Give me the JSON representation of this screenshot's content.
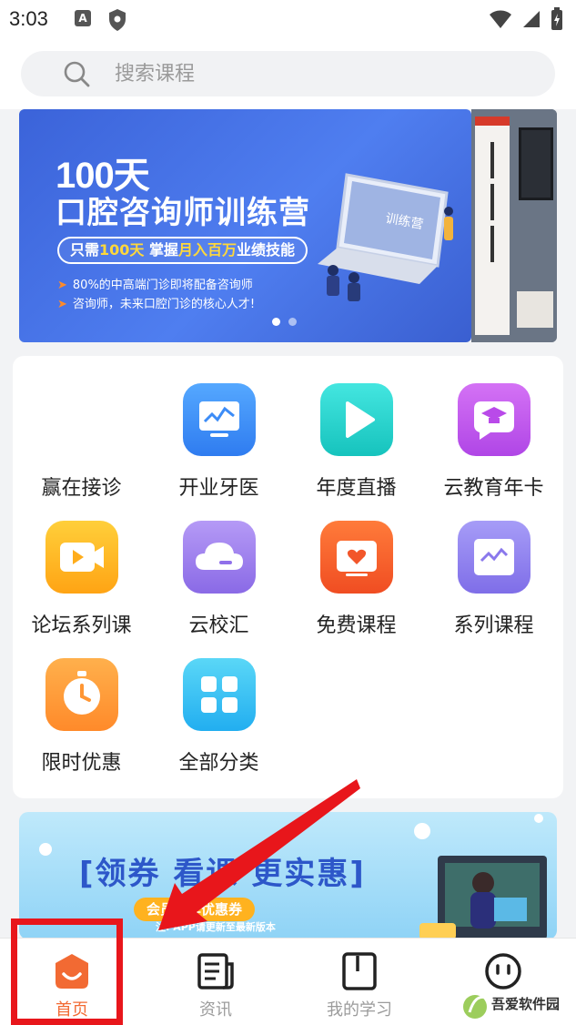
{
  "status_bar": {
    "time": "3:03",
    "notif_letter": "A"
  },
  "search": {
    "placeholder": "搜索课程"
  },
  "banner": {
    "title_line1": "100天",
    "title_line2": "口腔咨询师训练营",
    "pill_prefix": "只需",
    "pill_highlight1": "100天",
    "pill_mid": " 掌握",
    "pill_highlight2": "月入百万",
    "pill_suffix": "业绩技能",
    "bullet1": "80%的中高端门诊即将配备咨询师",
    "bullet2": "咨询师，未来口腔门诊的核心人才!",
    "screen_text": "训练营",
    "page_count": 2,
    "active_page": 1
  },
  "grid": {
    "items": [
      {
        "label": "赢在接诊",
        "icon": "none"
      },
      {
        "label": "开业牙医",
        "icon": "monitor-chart-icon"
      },
      {
        "label": "年度直播",
        "icon": "play-icon"
      },
      {
        "label": "云教育年卡",
        "icon": "graduation-chat-icon"
      },
      {
        "label": "论坛系列课",
        "icon": "video-camera-icon"
      },
      {
        "label": "云校汇",
        "icon": "cloud-icon"
      },
      {
        "label": "免费课程",
        "icon": "heart-screen-icon"
      },
      {
        "label": "系列课程",
        "icon": "chart-card-icon"
      },
      {
        "label": "限时优惠",
        "icon": "stopwatch-icon"
      },
      {
        "label": "全部分类",
        "icon": "grid-icon"
      }
    ]
  },
  "promo": {
    "title": "[领券  看课  更实惠]",
    "pill": "会员专享优惠券",
    "note": "注: APP请更新至最新版本"
  },
  "tabs": [
    {
      "label": "首页",
      "icon": "home-icon",
      "active": true
    },
    {
      "label": "资讯",
      "icon": "news-icon",
      "active": false
    },
    {
      "label": "我的学习",
      "icon": "book-icon",
      "active": false
    },
    {
      "label": "",
      "icon": "profile-face-icon",
      "active": false
    }
  ],
  "watermark": {
    "text": "吾爱软件园"
  },
  "colors": {
    "accent": "#f26a33",
    "highlight_red": "#e8161b",
    "banner_blue": "#4470e4"
  }
}
